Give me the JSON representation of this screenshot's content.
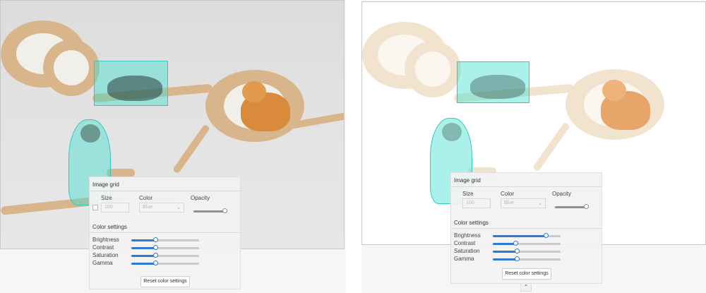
{
  "panels": [
    {
      "id": "left",
      "flyout": {
        "title": "Image grid",
        "size_label": "Size",
        "size_value": "100",
        "color_label": "Color",
        "color_value": "Blue",
        "opacity_label": "Opacity",
        "opacity_value": 0.92,
        "color_settings_title": "Color settings",
        "sliders": [
          {
            "label": "Brightness",
            "value": 0.35
          },
          {
            "label": "Contrast",
            "value": 0.35
          },
          {
            "label": "Saturation",
            "value": 0.35
          },
          {
            "label": "Gamma",
            "value": 0.35
          }
        ],
        "reset_label": "Reset color settings"
      }
    },
    {
      "id": "right",
      "flyout": {
        "title": "Image grid",
        "size_label": "Size",
        "size_value": "100",
        "color_label": "Color",
        "color_value": "Blue",
        "opacity_label": "Opacity",
        "opacity_value": 0.92,
        "color_settings_title": "Color settings",
        "sliders": [
          {
            "label": "Brightness",
            "value": 0.78
          },
          {
            "label": "Contrast",
            "value": 0.33
          },
          {
            "label": "Saturation",
            "value": 0.35
          },
          {
            "label": "Gamma",
            "value": 0.35
          }
        ],
        "reset_label": "Reset color settings"
      }
    }
  ],
  "icons": {
    "collapse": "chevron-up-icon",
    "dropdown": "chevron-down-icon"
  },
  "colors": {
    "accent": "#2f7bd1",
    "annotation": "#40e0d0"
  }
}
